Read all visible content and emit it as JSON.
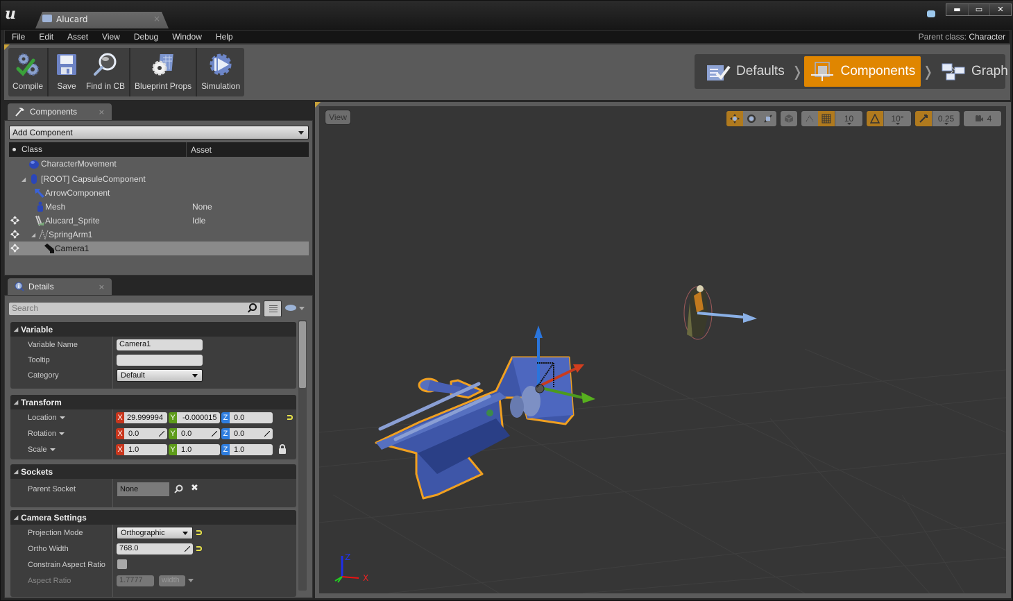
{
  "window": {
    "app_logo": "u",
    "document_tab": {
      "label": "Alucard",
      "icon": "blueprint-book-icon",
      "close": "×"
    },
    "feedback_icon": "speech-bubble-icon",
    "controls": {
      "minimize": "▬",
      "maximize": "▭",
      "close": "✕"
    }
  },
  "menu": {
    "items": [
      "File",
      "Edit",
      "Asset",
      "View",
      "Debug",
      "Window",
      "Help"
    ],
    "parent_class_label": "Parent class:",
    "parent_class_value": "Character"
  },
  "toolbar": {
    "buttons": [
      {
        "label": "Compile",
        "icon": "compile-gears-check-icon"
      },
      {
        "label": "Save",
        "icon": "floppy-disk-icon"
      },
      {
        "label": "Find in CB",
        "icon": "magnifier-icon"
      },
      {
        "label": "Blueprint Props",
        "icon": "blueprint-props-gear-icon"
      },
      {
        "label": "Simulation",
        "icon": "simulation-play-gear-icon"
      }
    ]
  },
  "modes": {
    "items": [
      {
        "label": "Defaults",
        "icon": "defaults-checklist-icon",
        "active": false
      },
      {
        "label": "Components",
        "icon": "components-cube-icon",
        "active": true
      },
      {
        "label": "Graph",
        "icon": "graph-nodes-icon",
        "active": false
      }
    ],
    "separator": "❭",
    "active_color": "#e08600"
  },
  "components_panel": {
    "tab_label": "Components",
    "tab_close": "×",
    "add_component_label": "Add Component",
    "columns": {
      "class": "Class",
      "asset": "Asset"
    },
    "rows": [
      {
        "name": "CharacterMovement",
        "asset": "",
        "icon": "movement-sphere-icon",
        "movable": false,
        "expandable": false,
        "selected": false
      },
      {
        "name": "[ROOT] CapsuleComponent",
        "asset": "",
        "icon": "capsule-icon",
        "movable": false,
        "expandable": true,
        "selected": false
      },
      {
        "name": "ArrowComponent",
        "asset": "",
        "icon": "arrow-component-icon",
        "movable": false,
        "expandable": false,
        "selected": false
      },
      {
        "name": "Mesh",
        "asset": "None",
        "icon": "skeletal-mesh-icon",
        "movable": false,
        "expandable": false,
        "selected": false
      },
      {
        "name": "Alucard_Sprite",
        "asset": "Idle",
        "icon": "sprite-icon",
        "movable": true,
        "expandable": false,
        "selected": false
      },
      {
        "name": "SpringArm1",
        "asset": "",
        "icon": "spring-arm-icon",
        "movable": true,
        "expandable": true,
        "selected": false
      },
      {
        "name": "Camera1",
        "asset": "",
        "icon": "camera-icon",
        "movable": true,
        "expandable": false,
        "selected": true
      }
    ]
  },
  "details_panel": {
    "tab_label": "Details",
    "tab_close": "×",
    "search_placeholder": "Search",
    "categories": {
      "variable": {
        "title": "Variable",
        "variable_name_label": "Variable Name",
        "variable_name_value": "Camera1",
        "tooltip_label": "Tooltip",
        "tooltip_value": "",
        "category_label": "Category",
        "category_value": "Default"
      },
      "transform": {
        "title": "Transform",
        "location_label": "Location",
        "rotation_label": "Rotation",
        "scale_label": "Scale",
        "location": {
          "x": "29.999994",
          "y": "-0.000015",
          "z": "0.0"
        },
        "rotation": {
          "x": "0.0",
          "y": "0.0",
          "z": "0.0"
        },
        "scale": {
          "x": "1.0",
          "y": "1.0",
          "z": "1.0"
        },
        "axis_labels": {
          "x": "X",
          "y": "Y",
          "z": "Z"
        },
        "axis_colors": {
          "x": "#c8361d",
          "y": "#5e9c1a",
          "z": "#2f7ee0"
        }
      },
      "sockets": {
        "title": "Sockets",
        "parent_socket_label": "Parent Socket",
        "parent_socket_value": "None",
        "clear_glyph": "✖"
      },
      "camera": {
        "title": "Camera Settings",
        "projection_mode_label": "Projection Mode",
        "projection_mode_value": "Orthographic",
        "ortho_width_label": "Ortho Width",
        "ortho_width_value": "768.0",
        "constrain_aspect_label": "Constrain Aspect Ratio",
        "constrain_aspect_checked": false,
        "aspect_ratio_label": "Aspect Ratio",
        "aspect_ratio_value": "1.7777",
        "aspect_ratio_mode": "width"
      }
    }
  },
  "viewport": {
    "view_button": "View",
    "toolbar": {
      "transform_modes": [
        "translate",
        "rotate",
        "scale"
      ],
      "grid_snap_value": "10",
      "rotation_snap_value": "10°",
      "scale_snap_value": "0.25",
      "camera_speed_value": "4"
    },
    "axis_indicator": {
      "z": "Z",
      "x": "X"
    }
  }
}
